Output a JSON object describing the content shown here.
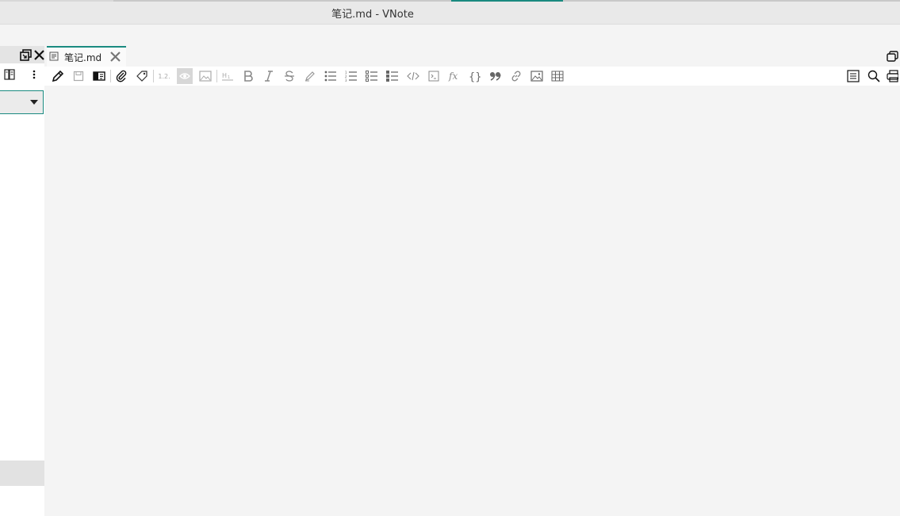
{
  "window": {
    "title": "笔记.md - VNote"
  },
  "tabs": [
    {
      "label": "笔记.md",
      "active": true
    }
  ],
  "toolbar": {
    "numbering_label": "1.2."
  },
  "colors": {
    "accent": "#1a8a80",
    "background": "#f4f4f4"
  },
  "icons": {
    "left_panel": [
      "dock-icon",
      "close-icon",
      "notebook-icon",
      "more-vertical-icon",
      "dropdown-arrow-icon"
    ],
    "tab": [
      "document-icon",
      "close-icon",
      "restore-window-icon"
    ],
    "toolbar": [
      "edit-icon",
      "save-icon",
      "view-mode-icon",
      "attachment-icon",
      "tag-icon",
      "numbering-icon",
      "preview-icon",
      "image-icon",
      "heading-icon",
      "bold-icon",
      "italic-icon",
      "strikethrough-icon",
      "highlight-icon",
      "bullet-list-icon",
      "numbered-list-icon",
      "todo-list-icon",
      "checked-list-icon",
      "inline-code-icon",
      "code-block-icon",
      "math-icon",
      "math-block-icon",
      "quote-icon",
      "link-icon",
      "insert-image-icon",
      "table-icon",
      "outline-icon",
      "search-icon",
      "print-icon"
    ]
  }
}
